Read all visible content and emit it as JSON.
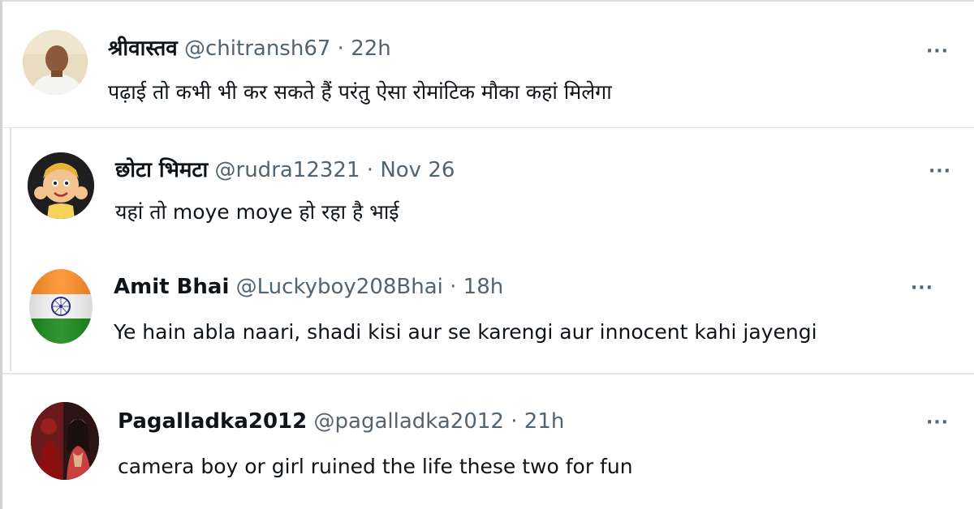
{
  "tweets": [
    {
      "name": "श्रीवास्तव",
      "handle": "@chitransh67",
      "separator": "·",
      "time": "22h",
      "text": "पढ़ाई तो कभी भी कर सकते हैं परंतु ऐसा रोमांटिक मौका कहां मिलेगा",
      "more": "···"
    },
    {
      "name": "छोटा भिमटा",
      "handle": "@rudra12321",
      "separator": "·",
      "time": "Nov 26",
      "text": "यहां तो moye moye हो रहा है भाई",
      "more": "···"
    },
    {
      "name": "Amit Bhai",
      "handle": "@Luckyboy208Bhai",
      "separator": "·",
      "time": "18h",
      "text": "Ye hain abla naari, shadi kisi aur se karengi aur innocent kahi jayengi",
      "more": "···"
    },
    {
      "name": "Pagalladka2012",
      "handle": "@pagalladka2012",
      "separator": "·",
      "time": "21h",
      "text": "camera boy or girl ruined the life these two for fun",
      "more": "···"
    }
  ],
  "colors": {
    "text": "#0f1419",
    "secondary": "#536471",
    "divider": "#e3e6e8",
    "saffron": "#ff9933",
    "green": "#138808",
    "chakra": "#000080"
  },
  "icons": {
    "more": "more-options-icon"
  }
}
